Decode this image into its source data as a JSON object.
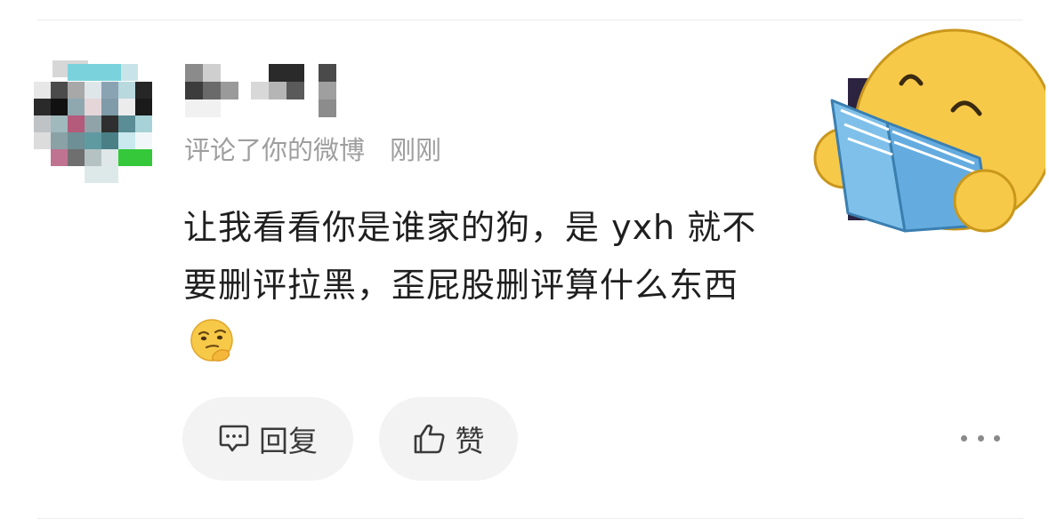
{
  "notification": {
    "action_text": "评论了你的微博",
    "time": "刚刚",
    "comment_text": "让我看看你是谁家的狗，是 yxh 就不要删评拉黑，歪屁股删评算什么东西",
    "emoji": "thinking-face-emoji"
  },
  "actions": {
    "reply_label": "回复",
    "like_label": "赞",
    "reply_icon": "comment-bubble-icon",
    "like_icon": "thumbs-up-icon",
    "more_icon": "more-dots-icon"
  },
  "sticker": {
    "name": "smiley-reading-book-sticker"
  },
  "colors": {
    "text_primary": "#1f1f1f",
    "text_secondary": "#9e9e9e",
    "pill_bg": "#f3f3f3",
    "sticker_yellow": "#f7c948",
    "book_blue": "#6fb5e3"
  }
}
